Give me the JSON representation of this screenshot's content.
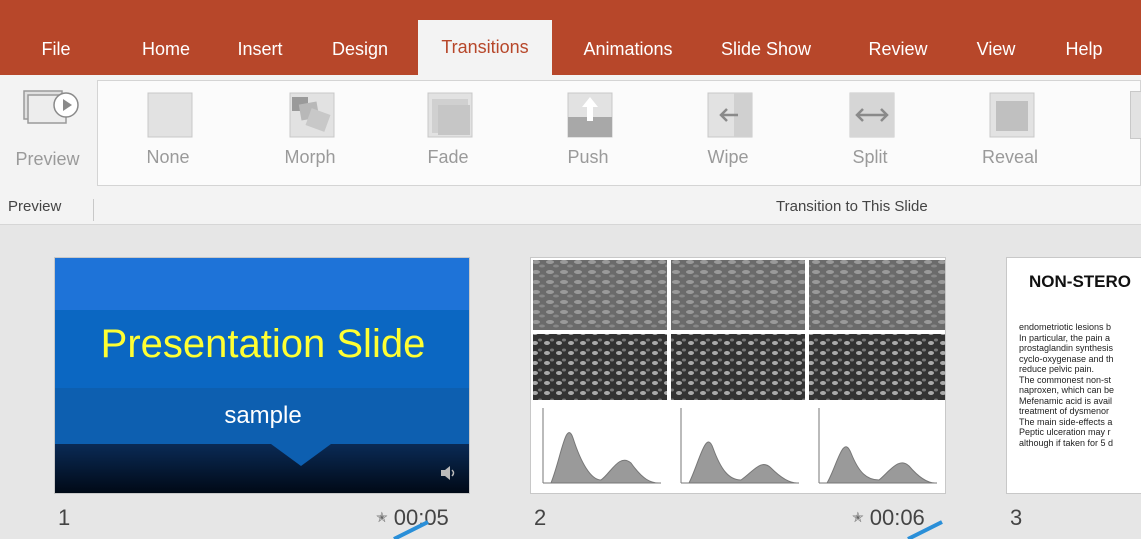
{
  "tabs": [
    {
      "label": "File"
    },
    {
      "label": "Home"
    },
    {
      "label": "Insert"
    },
    {
      "label": "Design"
    },
    {
      "label": "Transitions"
    },
    {
      "label": "Animations"
    },
    {
      "label": "Slide Show"
    },
    {
      "label": "Review"
    },
    {
      "label": "View"
    },
    {
      "label": "Help"
    }
  ],
  "ribbon": {
    "preview_label": "Preview",
    "preview_group_label": "Preview",
    "transitions": [
      {
        "label": "None",
        "icon": "none-icon"
      },
      {
        "label": "Morph",
        "icon": "morph-icon"
      },
      {
        "label": "Fade",
        "icon": "fade-icon"
      },
      {
        "label": "Push",
        "icon": "push-icon"
      },
      {
        "label": "Wipe",
        "icon": "wipe-icon"
      },
      {
        "label": "Split",
        "icon": "split-icon"
      },
      {
        "label": "Reveal",
        "icon": "reveal-icon"
      }
    ],
    "transition_group_label": "Transition to This Slide"
  },
  "slides": [
    {
      "number": "1",
      "title": "Presentation Slide",
      "subtitle": "sample",
      "time": "00:05"
    },
    {
      "number": "2",
      "time": "00:06"
    },
    {
      "number": "3",
      "title": "NON-STERO",
      "lines": [
        "endometriotic lesions b",
        "In particular, the pain a",
        "prostaglandin synthesis",
        "cyclo-oxygenase and th",
        "reduce pelvic pain.",
        "The commonest non-st",
        "naproxen, which can be",
        "Mefenamic acid is avail",
        "treatment of dysmenor",
        "The main side-effects a",
        "Peptic ulceration may r",
        "although if taken for 5 d"
      ]
    }
  ],
  "colors": {
    "accent": "#b7472a",
    "slide_blue": "#0078d4"
  }
}
